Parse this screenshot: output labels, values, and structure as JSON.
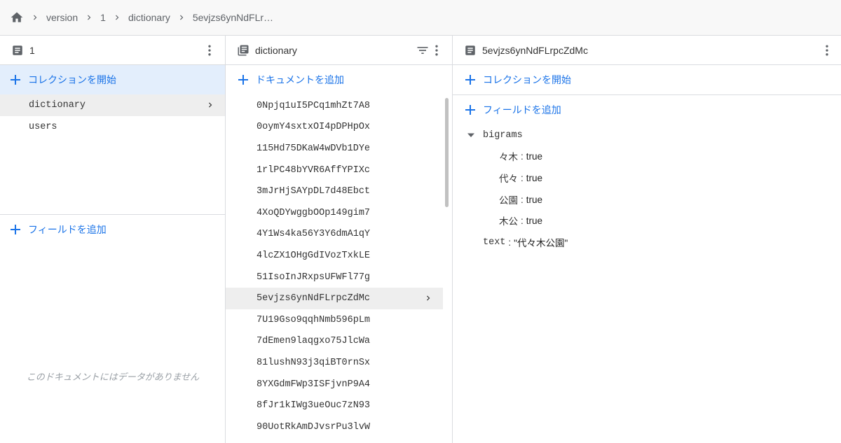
{
  "breadcrumb": {
    "home_icon": "home-icon",
    "items": [
      "version",
      "1",
      "dictionary",
      "5evjzs6ynNdFLr…"
    ]
  },
  "panel1": {
    "title": "1",
    "header_icon": "document-icon",
    "start_collection": "コレクションを開始",
    "collections": [
      "dictionary",
      "users"
    ],
    "add_field": "フィールドを追加",
    "empty_message": "このドキュメントにはデータがありません"
  },
  "panel2": {
    "title": "dictionary",
    "header_icon": "collection-icon",
    "add_document": "ドキュメントを追加",
    "documents": [
      "0Npjq1uI5PCq1mhZt7A8",
      "0oymY4sxtxOI4pDPHpOx",
      "115Hd75DKaW4wDVb1DYe",
      "1rlPC48bYVR6AffYPIXc",
      "3mJrHjSAYpDL7d48Ebct",
      "4XoQDYwggbOOp149gim7",
      "4Y1Ws4ka56Y3Y6dmA1qY",
      "4lcZX1OHgGdIVozTxkLE",
      "51IsoInJRxpsUFWFl77g",
      "5evjzs6ynNdFLrpcZdMc",
      "7U19Gso9qqhNmb596pLm",
      "7dEmen9laqgxo75JlcWa",
      "81lushN93j3qiBT0rnSx",
      "8YXGdmFWp3ISFjvnP9A4",
      "8fJr1kIWg3ueOuc7zN93",
      "90UotRkAmDJvsrPu3lvW"
    ],
    "selected_index": 9
  },
  "panel3": {
    "title": "5evjzs6ynNdFLrpcZdMc",
    "header_icon": "document-icon",
    "start_collection": "コレクションを開始",
    "add_field": "フィールドを追加",
    "map_field": {
      "key": "bigrams",
      "entries": [
        {
          "key": "々木",
          "value": "true"
        },
        {
          "key": "代々",
          "value": "true"
        },
        {
          "key": "公園",
          "value": "true"
        },
        {
          "key": "木公",
          "value": "true"
        }
      ]
    },
    "text_field": {
      "key": "text",
      "value": "\"代々木公園\""
    }
  },
  "colors": {
    "accent": "#1a73e8",
    "highlight": "#e3eefc",
    "selected_row": "#eeeeee",
    "border": "#dadce0"
  }
}
